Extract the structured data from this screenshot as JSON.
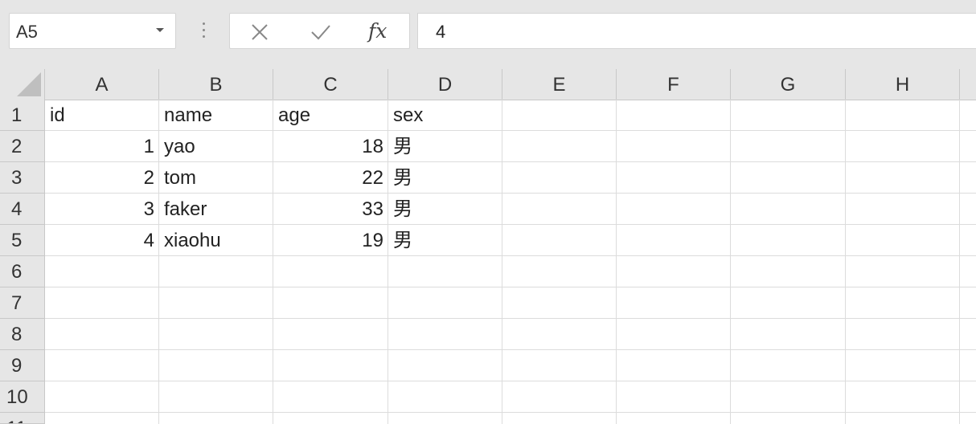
{
  "formula_bar": {
    "name_box": "A5",
    "cancel_icon": "close-icon",
    "enter_icon": "check-icon",
    "fx_label": "fx",
    "value": "4"
  },
  "columns": [
    "A",
    "B",
    "C",
    "D",
    "E",
    "F",
    "G",
    "H"
  ],
  "rows": [
    "1",
    "2",
    "3",
    "4",
    "5",
    "6",
    "7",
    "8",
    "9",
    "10",
    "11"
  ],
  "cells": {
    "r1": {
      "a": "id",
      "b": "name",
      "c": "age",
      "d": "sex"
    },
    "r2": {
      "a": "1",
      "b": "yao",
      "c": "18",
      "d": "男"
    },
    "r3": {
      "a": "2",
      "b": "tom",
      "c": "22",
      "d": "男"
    },
    "r4": {
      "a": "3",
      "b": "faker",
      "c": "33",
      "d": "男"
    },
    "r5": {
      "a": "4",
      "b": "xiaohu",
      "c": "19",
      "d": "男"
    }
  }
}
